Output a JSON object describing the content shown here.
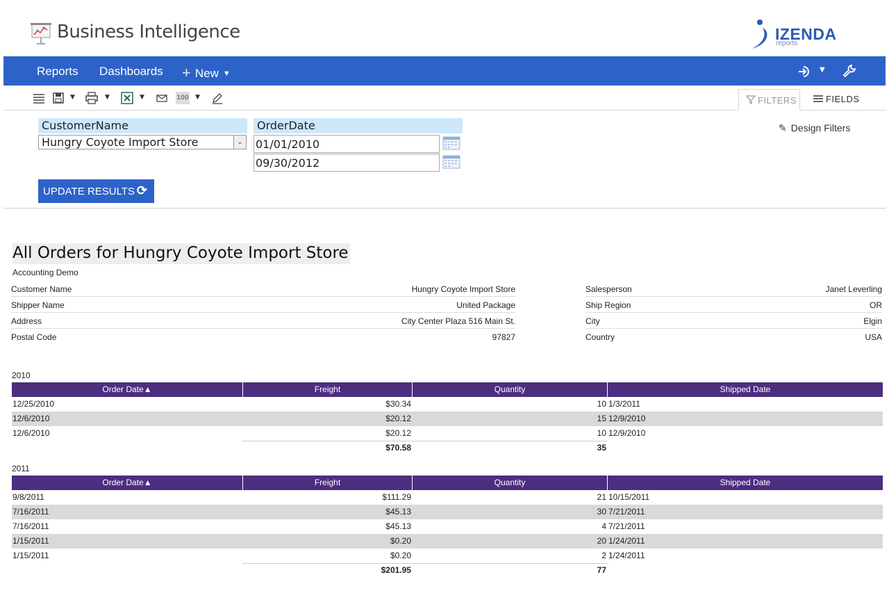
{
  "header": {
    "app_title": "Business Intelligence",
    "brand_name": "IZENDA",
    "brand_sub": "reports",
    "brand_color": "#2b5bb0"
  },
  "nav": {
    "reports": "Reports",
    "dashboards": "Dashboards",
    "new": "New",
    "bar_color": "#2d63c8",
    "icons": [
      "sign-in-icon",
      "chevron-down-icon",
      "wrench-icon"
    ]
  },
  "toolbar": {
    "icons": [
      "list-icon",
      "save-icon",
      "print-icon",
      "excel-icon",
      "mail-icon",
      "page-size-icon",
      "edit-icon"
    ],
    "page_size": "100",
    "tab_filters": "FILTERS",
    "tab_fields": "FIELDS"
  },
  "filters": {
    "customer_label": "CustomerName",
    "customer_value": "Hungry Coyote Import Store",
    "order_date_label": "OrderDate",
    "date_from": "01/01/2010",
    "date_to": "09/30/2012",
    "update_button": "UPDATE RESULTS",
    "design_filters": "Design Filters"
  },
  "report": {
    "title": "All Orders for Hungry Coyote Import Store",
    "subtitle": "Accounting Demo",
    "left_fields": [
      {
        "key": "Customer Name",
        "value": "Hungry Coyote Import Store"
      },
      {
        "key": "Shipper Name",
        "value": "United Package"
      },
      {
        "key": "Address",
        "value": "City Center Plaza 516 Main St."
      },
      {
        "key": "Postal Code",
        "value": "97827"
      }
    ],
    "right_fields": [
      {
        "key": "Salesperson",
        "value": "Janet Leverling"
      },
      {
        "key": "Ship Region",
        "value": "OR"
      },
      {
        "key": "City",
        "value": "Elgin"
      },
      {
        "key": "Country",
        "value": "USA"
      }
    ],
    "columns": [
      "Order Date▲",
      "Freight",
      "Quantity",
      "Shipped Date"
    ],
    "header_color": "#4d2d80",
    "groups": [
      {
        "year": "2010",
        "rows": [
          [
            "12/25/2010",
            "$30.34",
            "10",
            "1/3/2011"
          ],
          [
            "12/6/2010",
            "$20.12",
            "15",
            "12/9/2010"
          ],
          [
            "12/6/2010",
            "$20.12",
            "10",
            "12/9/2010"
          ]
        ],
        "total_freight": "$70.58",
        "total_quantity": "35"
      },
      {
        "year": "2011",
        "rows": [
          [
            "9/8/2011",
            "$111.29",
            "21",
            "10/15/2011"
          ],
          [
            "7/16/2011",
            "$45.13",
            "30",
            "7/21/2011"
          ],
          [
            "7/16/2011",
            "$45.13",
            "4",
            "7/21/2011"
          ],
          [
            "1/15/2011",
            "$0.20",
            "20",
            "1/24/2011"
          ],
          [
            "1/15/2011",
            "$0.20",
            "2",
            "1/24/2011"
          ]
        ],
        "total_freight": "$201.95",
        "total_quantity": "77"
      }
    ]
  }
}
